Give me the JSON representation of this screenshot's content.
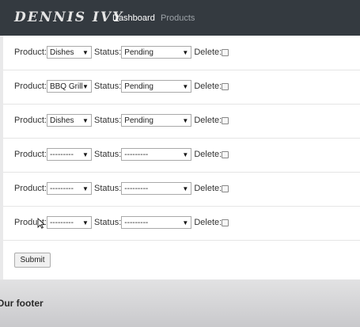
{
  "navbar": {
    "brand": "DENNIS IVY",
    "links": [
      {
        "label": "Dashboard",
        "active": true
      },
      {
        "label": "Products",
        "active": false
      }
    ]
  },
  "form": {
    "product_label": "Product:",
    "status_label": "Status:",
    "delete_label": "Delete:",
    "rows": [
      {
        "product": "Dishes",
        "status": "Pending",
        "delete_checked": false
      },
      {
        "product": "BBQ Grill",
        "status": "Pending",
        "delete_checked": false
      },
      {
        "product": "Dishes",
        "status": "Pending",
        "delete_checked": false
      },
      {
        "product": "---------",
        "status": "---------",
        "delete_checked": false
      },
      {
        "product": "---------",
        "status": "---------",
        "delete_checked": false
      },
      {
        "product": "---------",
        "status": "---------",
        "delete_checked": false
      }
    ],
    "submit_label": "Submit"
  },
  "footer": {
    "text": "Our footer"
  },
  "icons": {
    "caret": "chevron-down-icon",
    "cursor": "mouse-pointer-icon"
  },
  "colors": {
    "navbar": "#343a40",
    "nav_active": "#ffffff",
    "nav_inactive": "#9da3a8"
  }
}
